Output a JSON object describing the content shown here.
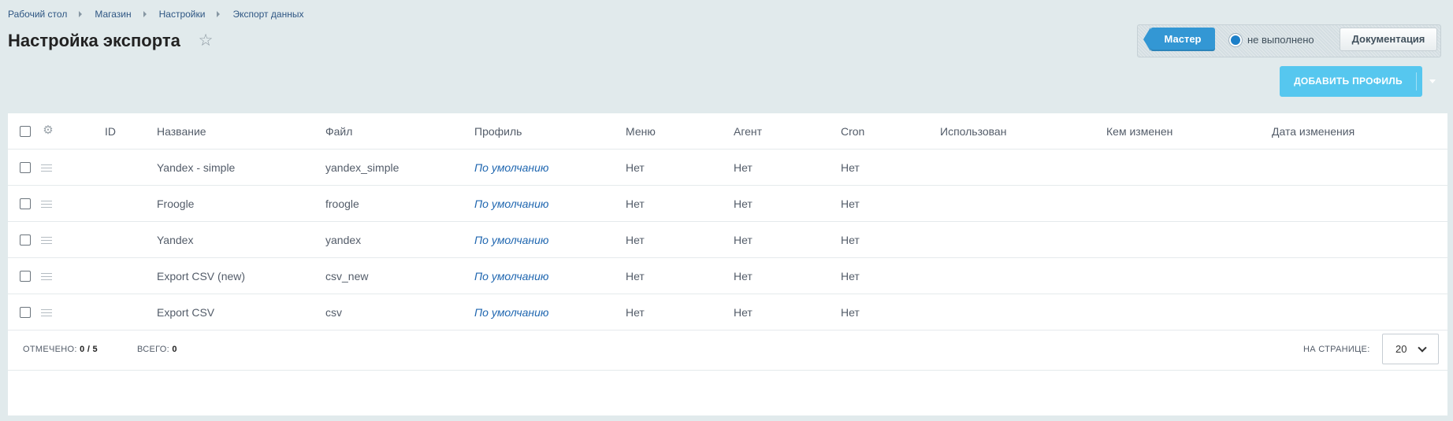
{
  "breadcrumb": [
    "Рабочий стол",
    "Магазин",
    "Настройки",
    "Экспорт данных"
  ],
  "title": "Настройка экспорта",
  "toolbar": {
    "master_label": "Мастер",
    "status_text": "не выполнено",
    "docs_label": "Документация"
  },
  "add_button": {
    "label": "ДОБАВИТЬ ПРОФИЛЬ"
  },
  "table": {
    "columns": [
      "ID",
      "Название",
      "Файл",
      "Профиль",
      "Меню",
      "Агент",
      "Cron",
      "Использован",
      "Кем изменен",
      "Дата изменения"
    ],
    "rows": [
      {
        "id": "",
        "name": "Yandex - simple",
        "file": "yandex_simple",
        "profile": "По умолчанию",
        "menu": "Нет",
        "agent": "Нет",
        "cron": "Нет",
        "used": "",
        "changed_by": "",
        "changed_at": ""
      },
      {
        "id": "",
        "name": "Froogle",
        "file": "froogle",
        "profile": "По умолчанию",
        "menu": "Нет",
        "agent": "Нет",
        "cron": "Нет",
        "used": "",
        "changed_by": "",
        "changed_at": ""
      },
      {
        "id": "",
        "name": "Yandex",
        "file": "yandex",
        "profile": "По умолчанию",
        "menu": "Нет",
        "agent": "Нет",
        "cron": "Нет",
        "used": "",
        "changed_by": "",
        "changed_at": ""
      },
      {
        "id": "",
        "name": "Export CSV (new)",
        "file": "csv_new",
        "profile": "По умолчанию",
        "menu": "Нет",
        "agent": "Нет",
        "cron": "Нет",
        "used": "",
        "changed_by": "",
        "changed_at": ""
      },
      {
        "id": "",
        "name": "Export CSV",
        "file": "csv",
        "profile": "По умолчанию",
        "menu": "Нет",
        "agent": "Нет",
        "cron": "Нет",
        "used": "",
        "changed_by": "",
        "changed_at": ""
      }
    ]
  },
  "footer": {
    "selected_label": "ОТМЕЧЕНО:",
    "selected_value": "0 / 5",
    "total_label": "ВСЕГО:",
    "total_value": "0",
    "per_page_label": "НА СТРАНИЦЕ:",
    "per_page_value": "20"
  },
  "icons": {
    "star": "star-icon",
    "gear": "gear-icon",
    "drag": "drag-handle-icon",
    "caret": "chevron-down-icon"
  },
  "colors": {
    "accent": "#3397d4",
    "add_button": "#56c7ef",
    "link": "#2067b0",
    "background": "#e1eaec"
  }
}
